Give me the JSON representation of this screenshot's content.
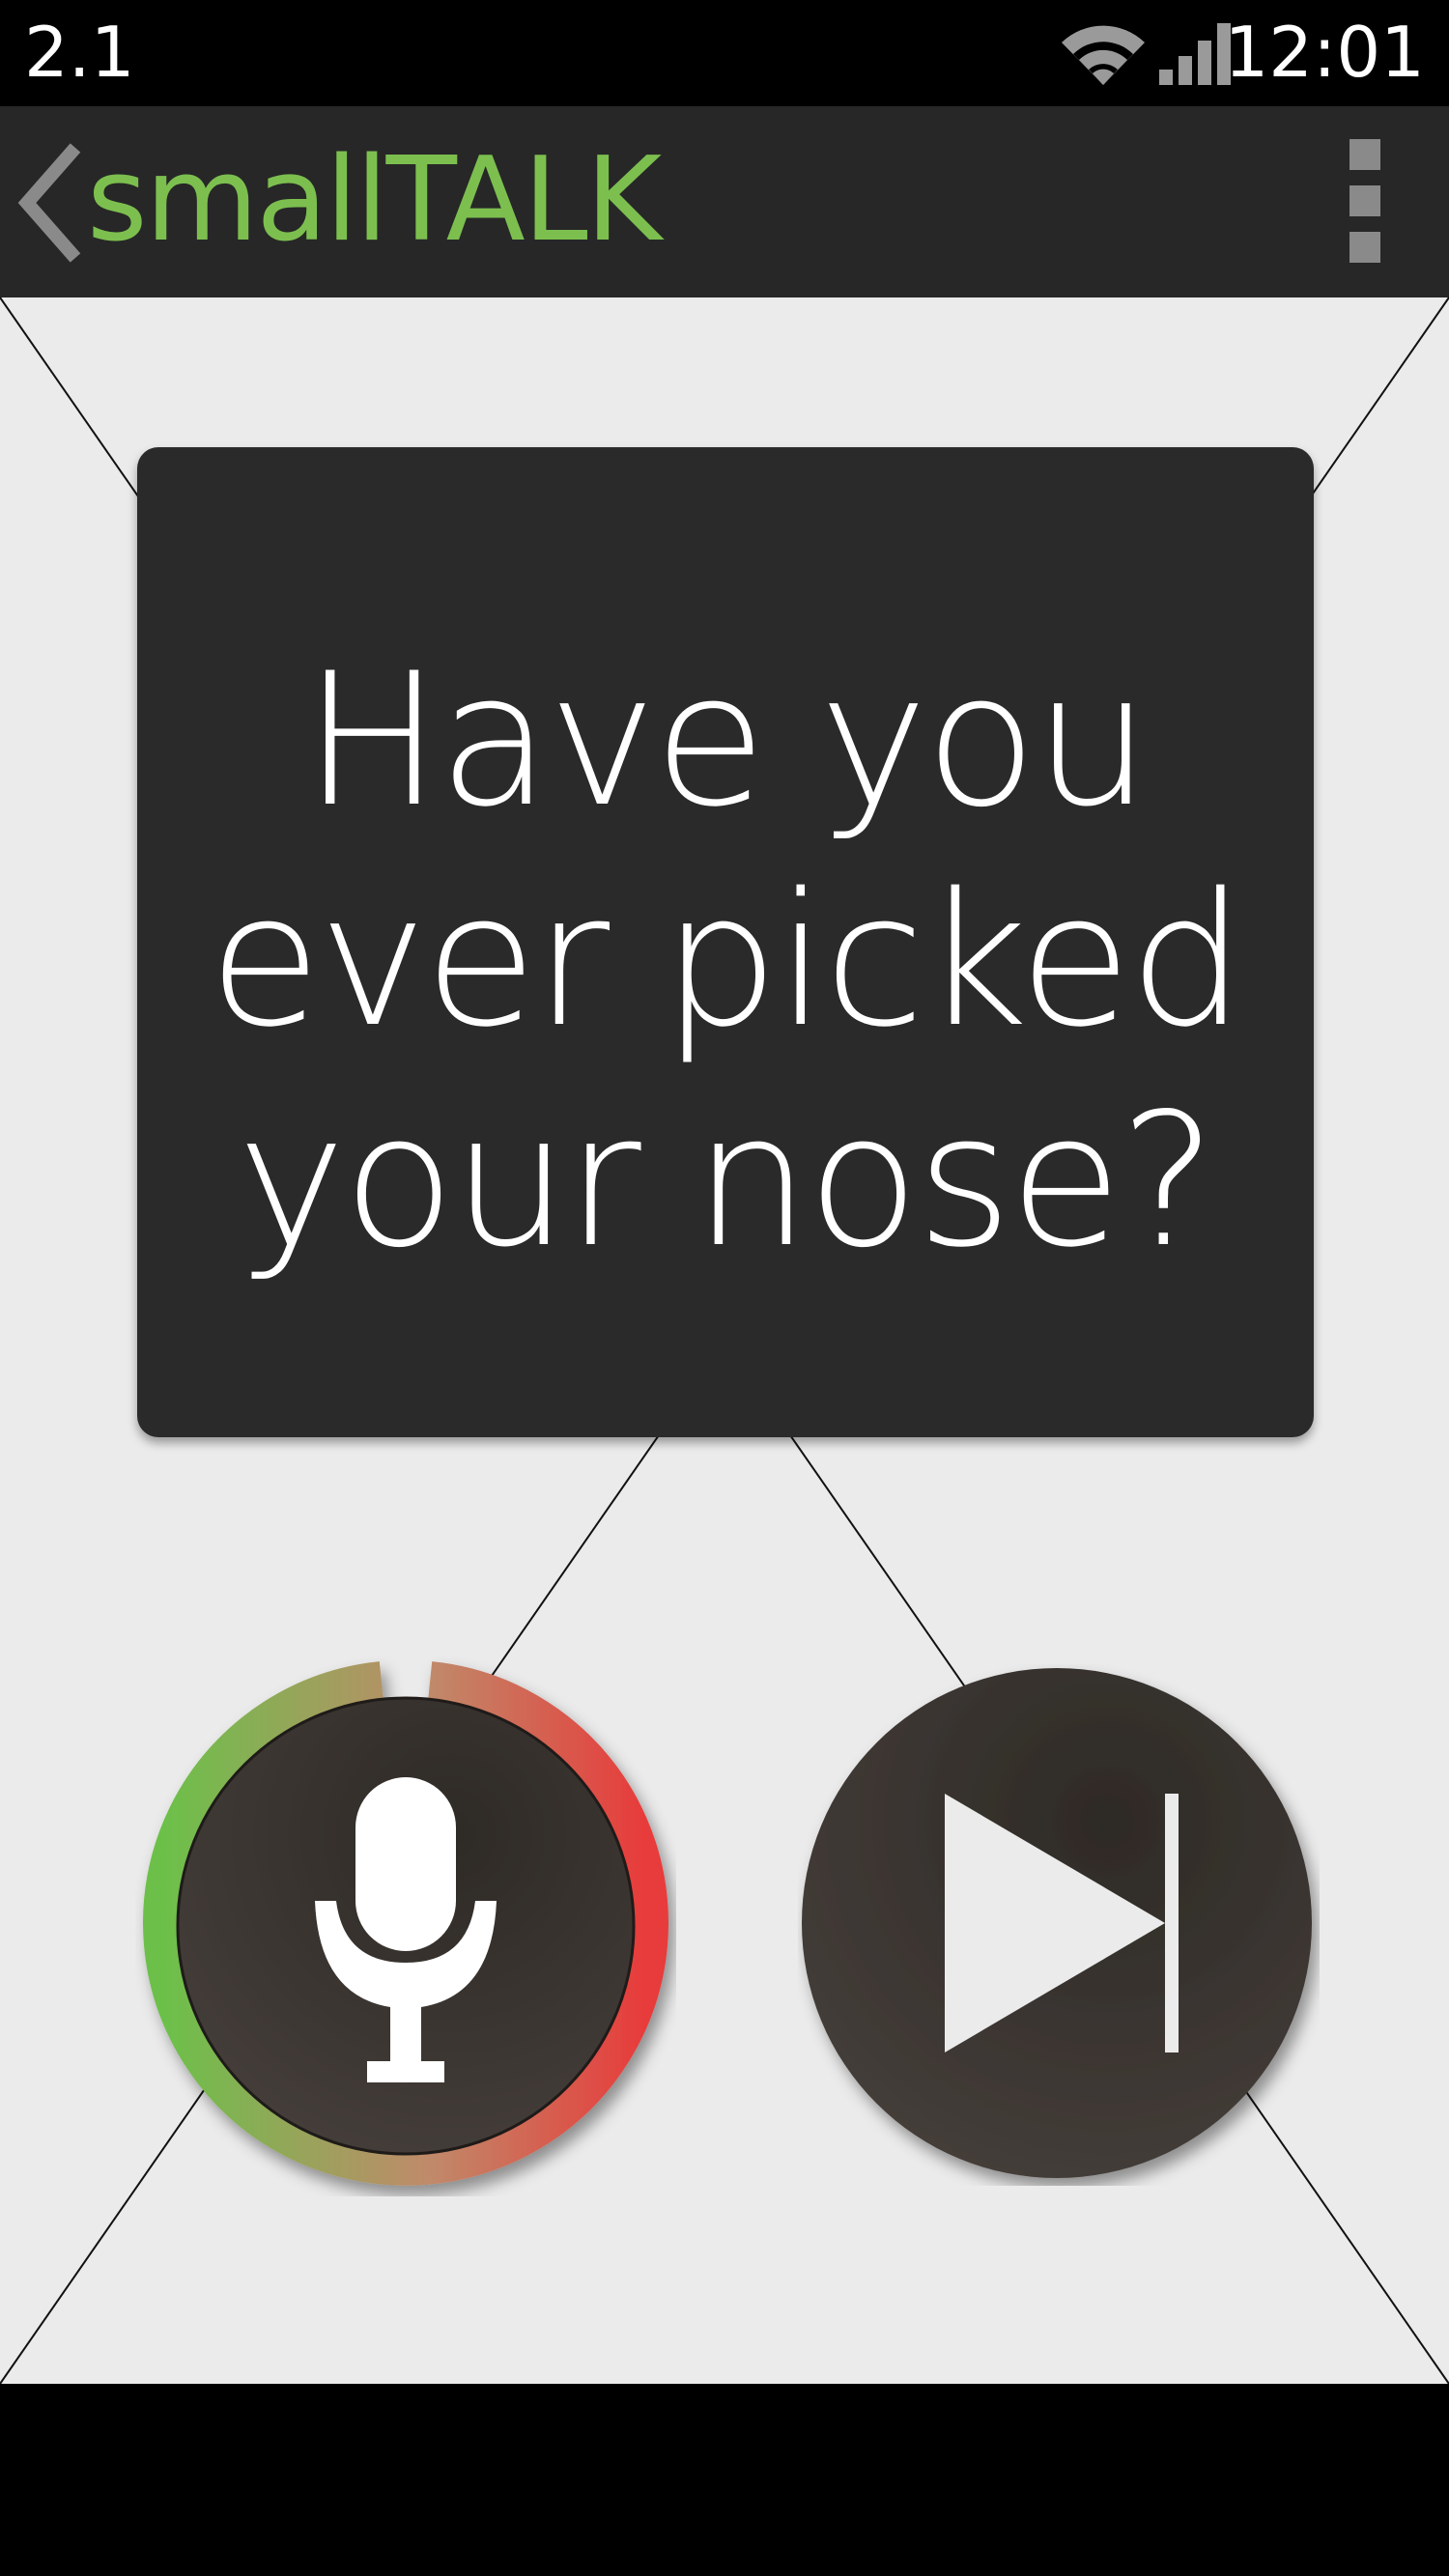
{
  "status_bar": {
    "left_text": "2.1",
    "time": "12:01"
  },
  "action_bar": {
    "title": "smallTALK",
    "title_color": "#7cbf4f"
  },
  "question_card": {
    "text": "Have you ever picked your nose?"
  },
  "controls": {
    "mic_icon": "microphone-icon",
    "skip_icon": "skip-next-icon",
    "level_ring_colors": [
      "#6cc04a",
      "#c08a6a",
      "#e83a3a"
    ]
  }
}
